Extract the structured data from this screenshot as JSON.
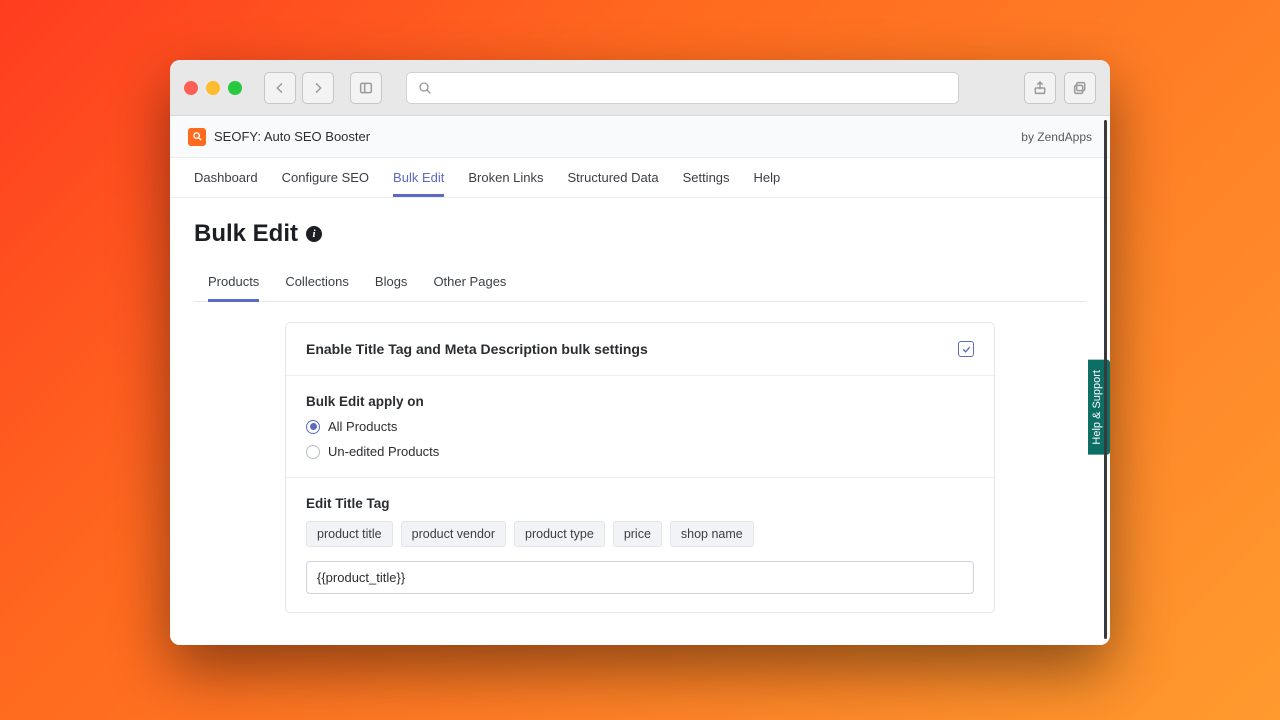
{
  "app": {
    "name": "SEOFY: Auto SEO Booster",
    "byline": "by ZendApps"
  },
  "nav": {
    "items": [
      {
        "label": "Dashboard"
      },
      {
        "label": "Configure SEO"
      },
      {
        "label": "Bulk Edit",
        "active": true
      },
      {
        "label": "Broken Links"
      },
      {
        "label": "Structured Data"
      },
      {
        "label": "Settings"
      },
      {
        "label": "Help"
      }
    ]
  },
  "page": {
    "title": "Bulk Edit"
  },
  "subtabs": [
    {
      "label": "Products",
      "active": true
    },
    {
      "label": "Collections"
    },
    {
      "label": "Blogs"
    },
    {
      "label": "Other Pages"
    }
  ],
  "enable_section": {
    "label": "Enable Title Tag and Meta Description bulk settings",
    "checked": true
  },
  "apply_section": {
    "title": "Bulk Edit apply on",
    "options": [
      {
        "label": "All Products",
        "selected": true
      },
      {
        "label": "Un-edited Products",
        "selected": false
      }
    ]
  },
  "title_section": {
    "title": "Edit Title Tag",
    "chips": [
      "product title",
      "product vendor",
      "product type",
      "price",
      "shop name"
    ],
    "input_value": "{{product_title}}"
  },
  "help_tab": "Help & Support"
}
